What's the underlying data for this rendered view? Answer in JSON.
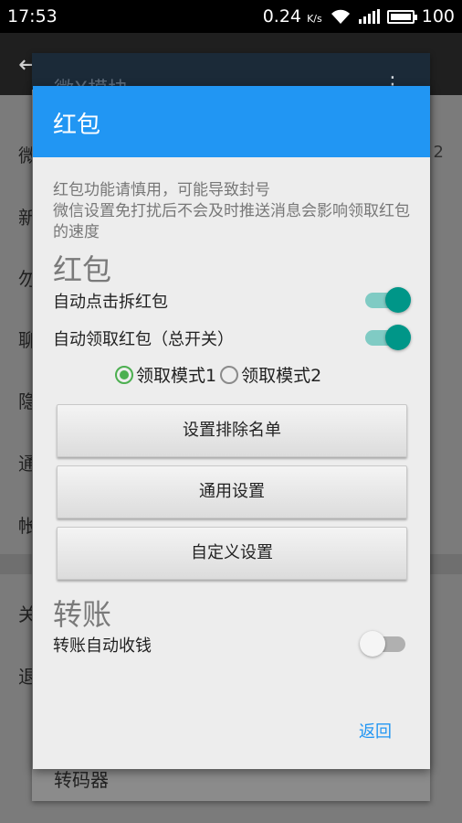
{
  "status_bar": {
    "time": "17:53",
    "speed": "0.24",
    "speed_unit": "K/s",
    "battery": "100"
  },
  "background": {
    "dialog_title": "微X模块",
    "list_items": [
      "微",
      "新",
      "勿",
      "聊",
      "隐",
      "通",
      "帐",
      "关",
      "退"
    ],
    "right_num": "2",
    "footer_text": "转码器"
  },
  "dialog": {
    "title": "红包",
    "warning": "红包功能请慎用，可能导致封号\n微信设置免打扰后不会及时推送消息会影响领取红包的速度",
    "section_redpacket": "红包",
    "auto_open_label": "自动点击拆红包",
    "auto_receive_label": "自动领取红包（总开关）",
    "mode1_label": "领取模式1",
    "mode2_label": "领取模式2",
    "btn_exclude": "设置排除名单",
    "btn_general": "通用设置",
    "btn_custom": "自定义设置",
    "section_transfer": "转账",
    "transfer_auto_label": "转账自动收钱",
    "back_label": "返回"
  },
  "state": {
    "auto_open": true,
    "auto_receive": true,
    "mode_selected": 1,
    "transfer_auto": false
  },
  "colors": {
    "header": "#2196f3",
    "switch_on": "#009688",
    "radio_checked": "#4caf50"
  }
}
